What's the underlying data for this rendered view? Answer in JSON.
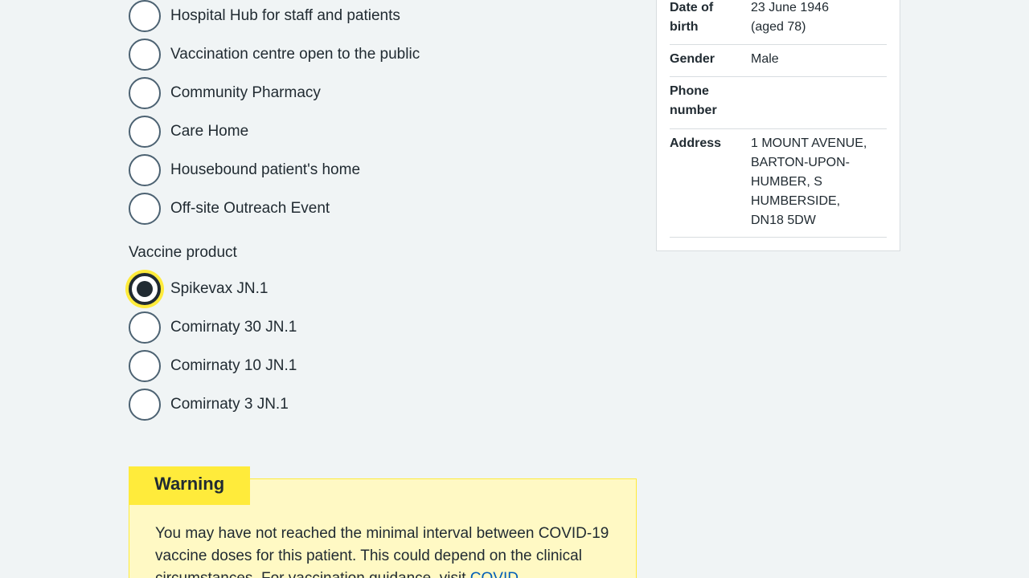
{
  "delivery_site": {
    "options": [
      {
        "label": "Hospital Hub for staff and patients",
        "checked": false
      },
      {
        "label": "Vaccination centre open to the public",
        "checked": false
      },
      {
        "label": "Community Pharmacy",
        "checked": false
      },
      {
        "label": "Care Home",
        "checked": false
      },
      {
        "label": "Housebound patient's home",
        "checked": false
      },
      {
        "label": "Off-site Outreach Event",
        "checked": false
      }
    ]
  },
  "vaccine_product": {
    "legend": "Vaccine product",
    "options": [
      {
        "label": "Spikevax JN.1",
        "checked": true
      },
      {
        "label": "Comirnaty 30 JN.1",
        "checked": false
      },
      {
        "label": "Comirnaty 10 JN.1",
        "checked": false
      },
      {
        "label": "Comirnaty 3 JN.1",
        "checked": false
      }
    ]
  },
  "warning": {
    "heading": "Warning",
    "body_text": "You may have not reached the minimal interval between COVID-19 vaccine doses for this patient. This could depend on the clinical circumstances. For vaccination guidance, visit ",
    "link_text": "COVID"
  },
  "patient": {
    "dob_key": "Date of birth",
    "dob_value": "23 June 1946",
    "dob_age": "(aged 78)",
    "gender_key": "Gender",
    "gender_value": "Male",
    "phone_key": "Phone number",
    "phone_value": "",
    "address_key": "Address",
    "address_value": "1 MOUNT AVENUE, BARTON-UPON-HUMBER, S HUMBERSIDE, DN18 5DW"
  },
  "colors": {
    "background": "#f0f4f5",
    "text": "#212b32",
    "radio_border": "#4c6272",
    "focus_yellow": "#ffeb3b",
    "warning_bg": "#fff9c4",
    "link": "#005eb8"
  }
}
